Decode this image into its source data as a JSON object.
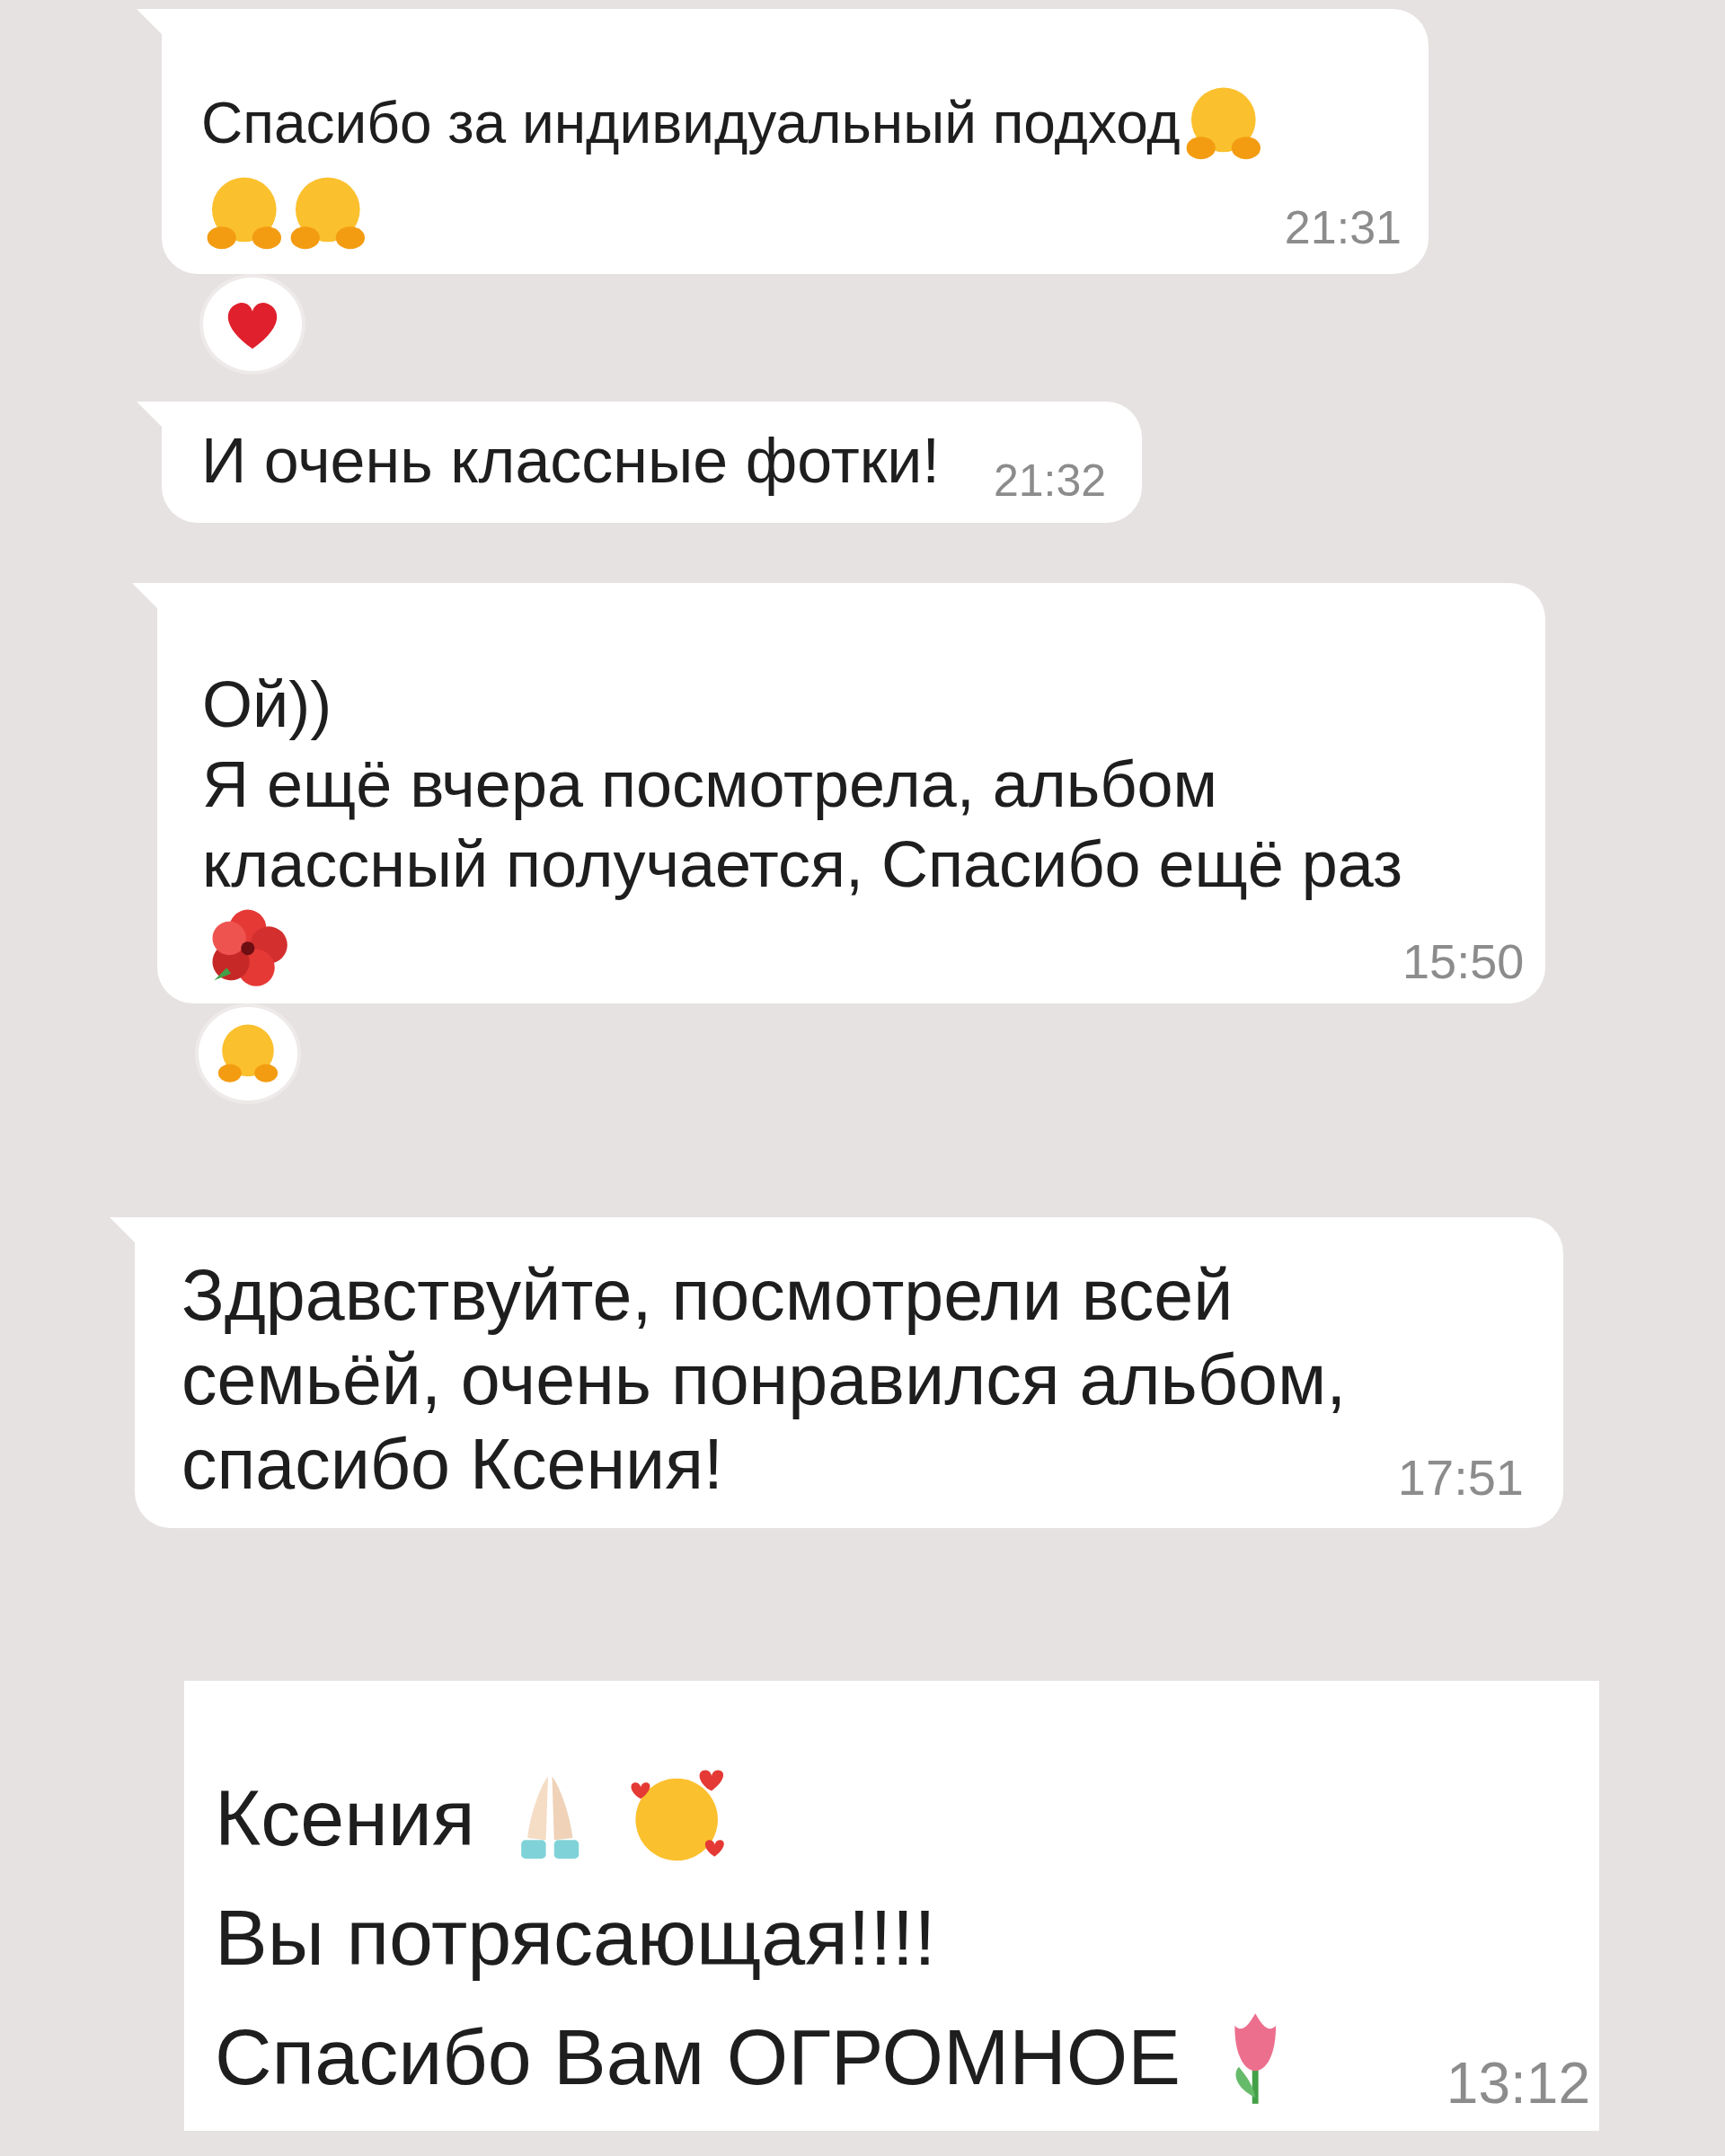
{
  "messages": [
    {
      "kind": "tail",
      "lines": [
        [
          {
            "kind": "text",
            "text": "Спасибо за индивидуальный подход"
          },
          {
            "kind": "hug"
          }
        ],
        [
          {
            "kind": "hug"
          },
          {
            "kind": "hug"
          }
        ]
      ],
      "time": "21:31",
      "reaction": {
        "kind": "heart"
      }
    },
    {
      "kind": "tail",
      "lines": [
        [
          {
            "kind": "text",
            "text": "И очень классные фотки!"
          }
        ]
      ],
      "time": "21:32"
    },
    {
      "kind": "tail",
      "lines": [
        [
          {
            "kind": "text",
            "text": "Ой))"
          }
        ],
        [
          {
            "kind": "text",
            "text": "Я ещё вчера посмотрела, альбом"
          }
        ],
        [
          {
            "kind": "text",
            "text": "классный получается, Спасибо ещё раз"
          }
        ],
        [
          {
            "kind": "hibiscus"
          }
        ]
      ],
      "time": "15:50",
      "reaction": {
        "kind": "hug"
      }
    },
    {
      "kind": "tail",
      "lines": [
        [
          {
            "kind": "text",
            "text": "Здравствуйте, посмотрели всей"
          }
        ],
        [
          {
            "kind": "text",
            "text": "семьёй, очень понравился альбом,"
          }
        ],
        [
          {
            "kind": "text",
            "text": "спасибо Ксения!"
          }
        ]
      ],
      "time": "17:51"
    },
    {
      "kind": "plain",
      "lines": [
        [
          {
            "kind": "text",
            "text": "Ксения"
          },
          {
            "kind": "pray"
          },
          {
            "kind": "hearts"
          }
        ],
        [
          {
            "kind": "text",
            "text": "Вы потрясающая!!!!"
          }
        ],
        [
          {
            "kind": "text",
            "text": "Спасибо Вам ОГРОМНОЕ"
          },
          {
            "kind": "tulip"
          }
        ]
      ],
      "time": "13:12"
    }
  ]
}
